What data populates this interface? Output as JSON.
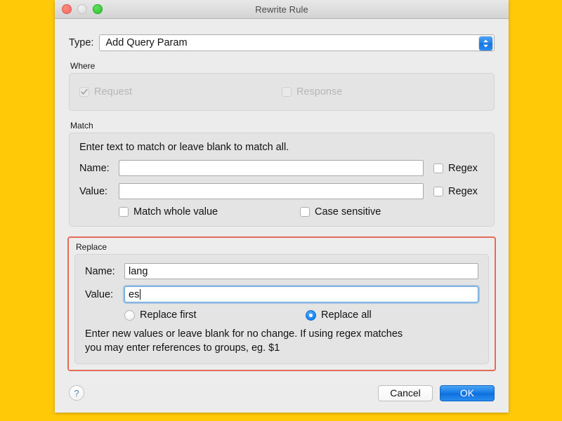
{
  "desktop": {
    "background_color": "#FFC907"
  },
  "window": {
    "title": "Rewrite Rule",
    "traffic_lights": {
      "close": "close-button",
      "minimize": "minimize-button",
      "zoom": "zoom-button"
    }
  },
  "type_row": {
    "label": "Type:",
    "selected": "Add Query Param",
    "stepper_icon": "up-down-chevron-icon"
  },
  "where": {
    "caption": "Where",
    "request": {
      "label": "Request",
      "checked": true,
      "disabled": true
    },
    "response": {
      "label": "Response",
      "checked": false,
      "disabled": true
    }
  },
  "match": {
    "caption": "Match",
    "hint": "Enter text to match or leave blank to match all.",
    "name": {
      "label": "Name:",
      "value": "",
      "placeholder": ""
    },
    "value": {
      "label": "Value:",
      "value": "",
      "placeholder": ""
    },
    "name_regex": {
      "label": "Regex",
      "checked": false
    },
    "value_regex": {
      "label": "Regex",
      "checked": false
    },
    "match_whole_value": {
      "label": "Match whole value",
      "checked": false
    },
    "case_sensitive": {
      "label": "Case sensitive",
      "checked": false
    }
  },
  "replace": {
    "caption": "Replace",
    "highlight_color": "#E46A5A",
    "name": {
      "label": "Name:",
      "value": "lang",
      "focused": false
    },
    "value": {
      "label": "Value:",
      "value": "es",
      "focused": true
    },
    "replace_first": {
      "label": "Replace first",
      "selected": false
    },
    "replace_all": {
      "label": "Replace all",
      "selected": true
    },
    "note_line1": "Enter new values or leave blank for no change. If using regex matches",
    "note_line2": "you may enter references to groups, eg. $1"
  },
  "footer": {
    "help_label": "?",
    "cancel_label": "Cancel",
    "ok_label": "OK",
    "ok_accent": "#1379E6"
  }
}
